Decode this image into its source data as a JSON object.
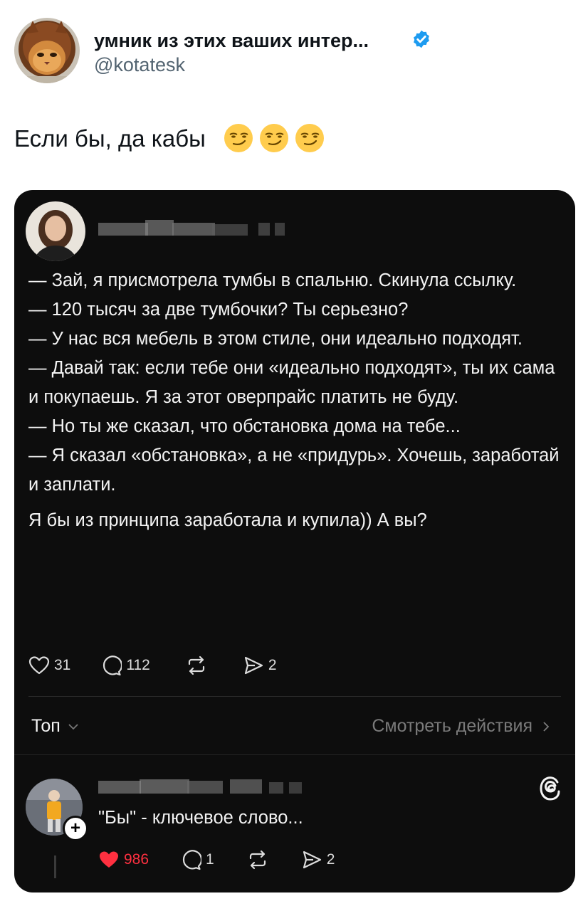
{
  "tweet": {
    "author_name": "умник из этих ваших интер...",
    "author_handle": "@kotatesk",
    "text": "Если бы, да кабы",
    "emojis": [
      "smirking-face",
      "smirking-face",
      "smirking-face"
    ]
  },
  "threads_post": {
    "lines": [
      "— Зай, я присмотрела тумбы в спальню. Скинула ссылку.",
      "— 120 тысяч за две тумбочки? Ты серьезно?",
      "— У нас вся мебель в этом стиле, они идеально подходят.",
      "— Давай так: если тебе они «идеально подходят», ты их сама и покупаешь. Я за этот оверпрайс платить не буду.",
      "— Но ты же сказал, что обстановка дома на тебе...",
      "— Я сказал «обстановка», а не «придурь». Хочешь, заработай и заплати."
    ],
    "question": "Я бы из принципа заработала и купила)) А вы?",
    "stats": {
      "likes": "31",
      "comments": "112",
      "shares": "2"
    }
  },
  "sort": {
    "label": "Топ",
    "view_activity": "Смотреть действия"
  },
  "reply": {
    "text": "\"Бы\" - ключевое слово...",
    "stats": {
      "likes": "986",
      "comments": "1",
      "shares": "2"
    }
  },
  "colors": {
    "verified": "#1d9bf0",
    "card_bg": "#0d0d0d",
    "like_red": "#ff3040"
  }
}
